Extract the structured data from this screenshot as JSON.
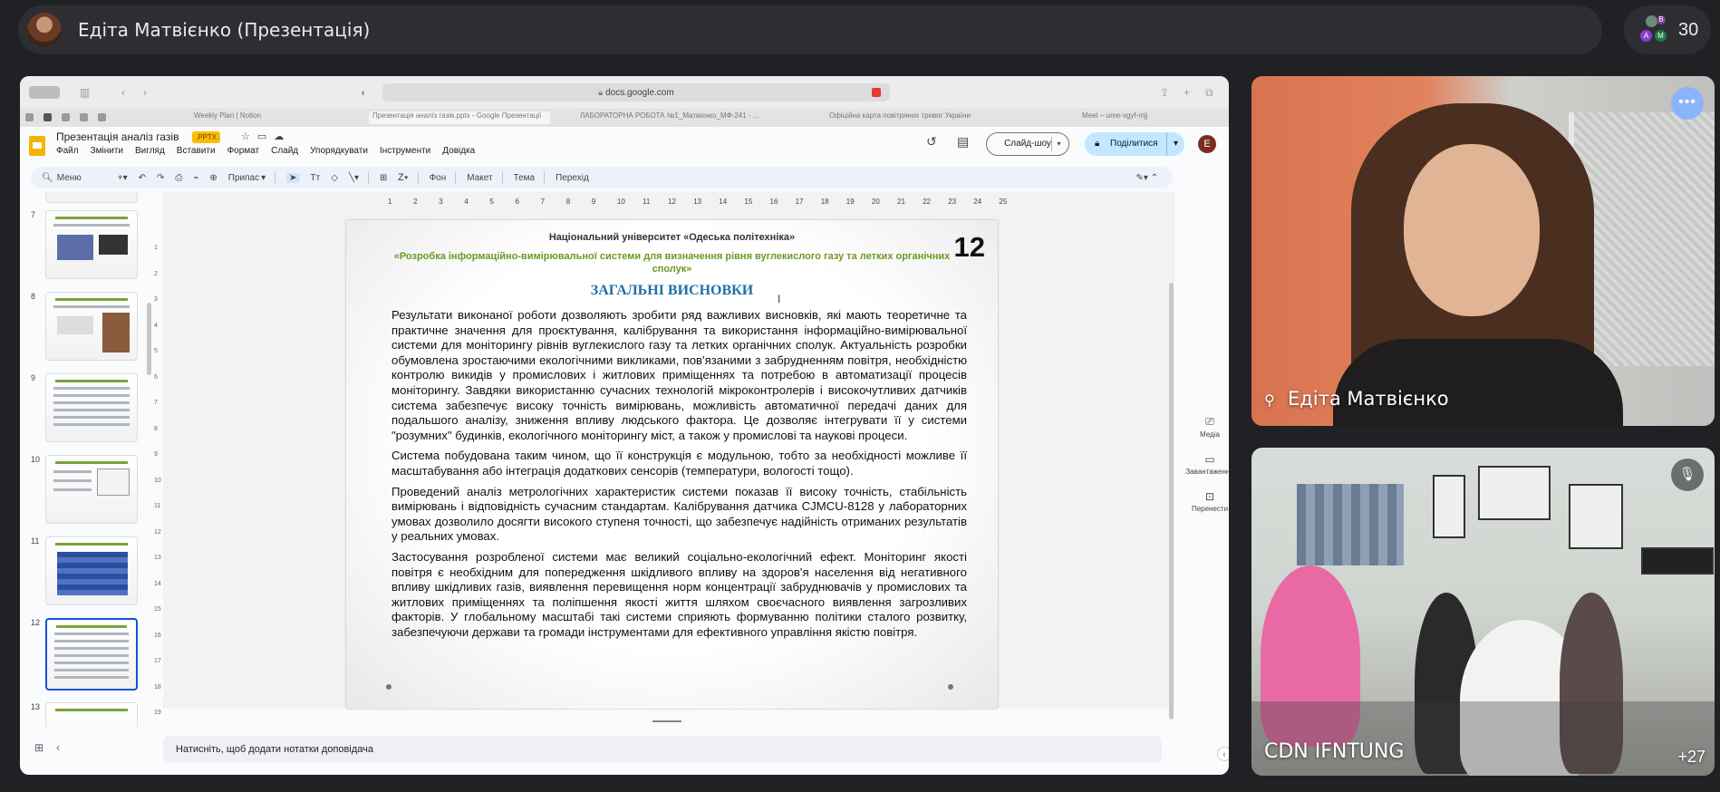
{
  "meet": {
    "presenter_title": "Едіта Матвієнко (Презентація)",
    "participant_count": "30",
    "mini_avatars": [
      "A",
      "M",
      "B"
    ]
  },
  "browser": {
    "url": "docs.google.com",
    "tabs": [
      "Weekly Plan | Notion",
      "Презентація аналіз газів.pptx - Google Презентації",
      "ЛАБОРАТОРНА РОБОТА №1_Матвієнко_МФ-241 - ...",
      "Офіційна карта повітряних тривог України",
      "Meet – ume-vgyf-mjj"
    ]
  },
  "docs": {
    "title": "Презентація аналіз газів",
    "badge": ".PPTX",
    "menu": [
      "Файл",
      "Змінити",
      "Вигляд",
      "Вставити",
      "Формат",
      "Слайд",
      "Упорядкувати",
      "Інструменти",
      "Довідка"
    ],
    "slideshow_label": "Слайд-шоу",
    "share_label": "Поділитися",
    "user_initial": "E",
    "toolbar": {
      "menu_search": "Меню",
      "fit": "Припас",
      "background": "Фон",
      "layout": "Макет",
      "theme": "Тема",
      "transition": "Перехід"
    },
    "slide_numbers": [
      "7",
      "8",
      "9",
      "10",
      "11",
      "12",
      "13"
    ],
    "ruler_h": [
      "1",
      "2",
      "3",
      "4",
      "5",
      "6",
      "7",
      "8",
      "9",
      "10",
      "11",
      "12",
      "13",
      "14",
      "15",
      "16",
      "17",
      "18",
      "19",
      "20",
      "21",
      "22",
      "23",
      "24",
      "25"
    ],
    "ruler_v": [
      "1",
      "2",
      "3",
      "4",
      "5",
      "6",
      "7",
      "8",
      "9",
      "10",
      "11",
      "12",
      "13",
      "14",
      "15",
      "16",
      "17",
      "18",
      "19"
    ],
    "side_panel": [
      "Медіа",
      "Завантаження",
      "Перенести"
    ],
    "notes_placeholder": "Натисніть, щоб додати нотатки доповідача"
  },
  "slide": {
    "university": "Національний університет «Одеська політехніка»",
    "number": "12",
    "project_title": "«Розробка інформаційно-вимірювальної системи для визначення рівня вуглекислого газу та летких органічних сполук»",
    "heading": "ЗАГАЛЬНІ ВИСНОВКИ",
    "paragraphs": [
      "Результати виконаної роботи дозволяють зробити ряд важливих висновків, які мають теоретичне та практичне значення для проєктування, калібрування та використання інформаційно-вимірювальної системи для моніторингу рівнів вуглекислого газу та летких органічних сполук. Актуальність розробки обумовлена зростаючими екологічними викликами, пов'язаними з забрудненням повітря, необхідністю контролю викидів у промислових і житлових приміщеннях та потребою в автоматизації процесів моніторингу. Завдяки використанню сучасних технологій мікроконтролерів і високочутливих датчиків система забезпечує високу точність вимірювань, можливість автоматичної передачі даних для подальшого аналізу, зниження впливу людського фактора. Це дозволяє інтегрувати її у системи \"розумних\" будинків, екологічного моніторингу міст, а також у промислові та наукові процеси.",
      "Система побудована таким чином, що її конструкція є модульною, тобто за необхідності можливе її масштабування або інтеграція додаткових сенсорів (температури, вологості тощо).",
      "Проведений аналіз метрологічних характеристик системи показав її високу точність, стабільність вимірювань і відповідність сучасним стандартам. Калібрування датчика CJMCU-8128 у лабораторних умовах дозволило досягти високого ступеня точності, що забезпечує надійність отриманих результатів у реальних умовах.",
      "Застосування розробленої системи має великий соціально-екологічний ефект. Моніторинг якості повітря є необхідним для попередження шкідливого впливу на здоров'я населення від негативного впливу шкідливих газів, виявлення перевищення норм концентрації забруднювачів у промислових та житлових приміщеннях та поліпшення якості життя шляхом своєчасного виявлення загрозливих факторів. У глобальному масштабі такі системи сприяють формуванню політики сталого розвитку, забезпечуючи держави та громади інструментами для ефективного управління якістю повітря."
    ]
  },
  "participants": {
    "edita_name": "Едіта Матвієнко",
    "cdn_name": "CDN IFNTUNG",
    "more_count": "+27"
  }
}
